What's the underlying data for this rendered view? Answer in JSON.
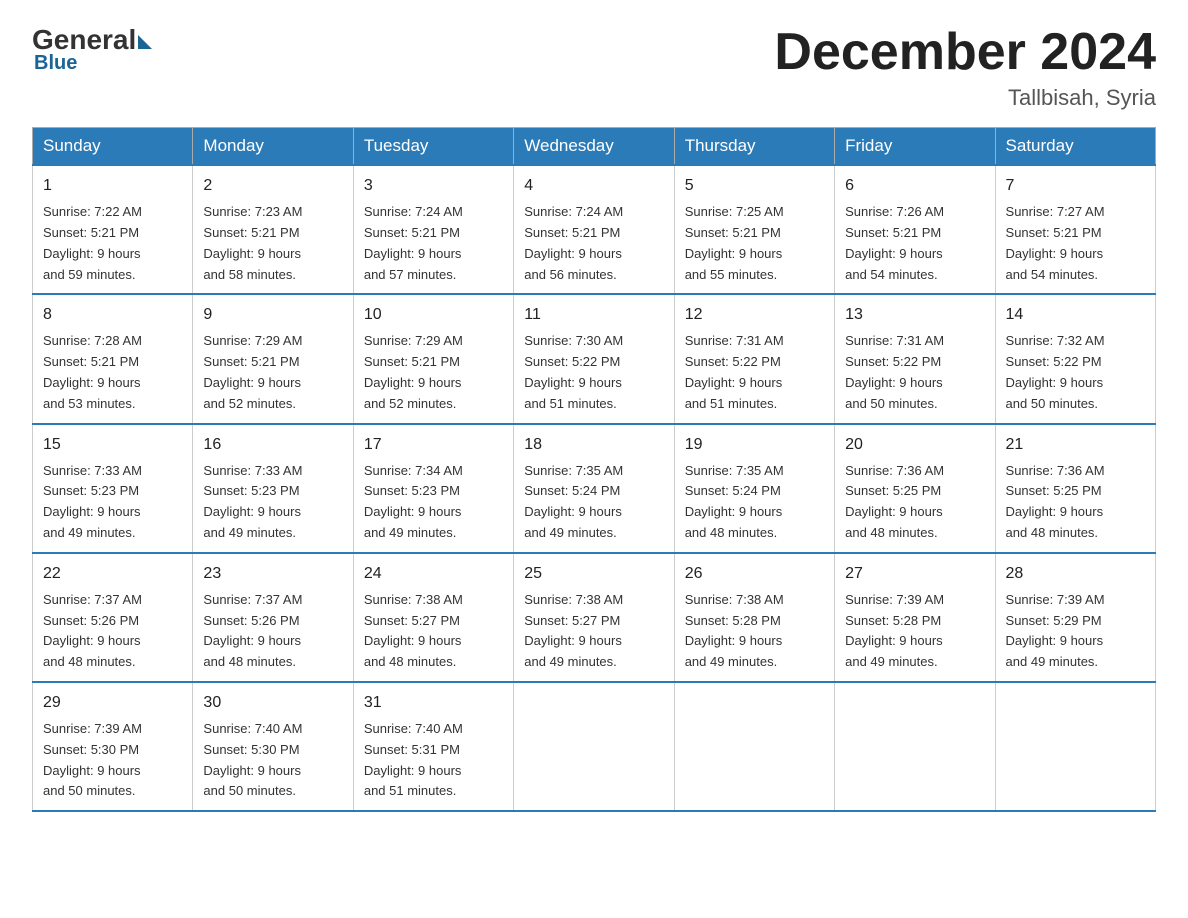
{
  "logo": {
    "general": "General",
    "blue": "Blue"
  },
  "title": "December 2024",
  "location": "Tallbisah, Syria",
  "days_of_week": [
    "Sunday",
    "Monday",
    "Tuesday",
    "Wednesday",
    "Thursday",
    "Friday",
    "Saturday"
  ],
  "weeks": [
    [
      {
        "day": "1",
        "sunrise": "7:22 AM",
        "sunset": "5:21 PM",
        "daylight": "9 hours and 59 minutes."
      },
      {
        "day": "2",
        "sunrise": "7:23 AM",
        "sunset": "5:21 PM",
        "daylight": "9 hours and 58 minutes."
      },
      {
        "day": "3",
        "sunrise": "7:24 AM",
        "sunset": "5:21 PM",
        "daylight": "9 hours and 57 minutes."
      },
      {
        "day": "4",
        "sunrise": "7:24 AM",
        "sunset": "5:21 PM",
        "daylight": "9 hours and 56 minutes."
      },
      {
        "day": "5",
        "sunrise": "7:25 AM",
        "sunset": "5:21 PM",
        "daylight": "9 hours and 55 minutes."
      },
      {
        "day": "6",
        "sunrise": "7:26 AM",
        "sunset": "5:21 PM",
        "daylight": "9 hours and 54 minutes."
      },
      {
        "day": "7",
        "sunrise": "7:27 AM",
        "sunset": "5:21 PM",
        "daylight": "9 hours and 54 minutes."
      }
    ],
    [
      {
        "day": "8",
        "sunrise": "7:28 AM",
        "sunset": "5:21 PM",
        "daylight": "9 hours and 53 minutes."
      },
      {
        "day": "9",
        "sunrise": "7:29 AM",
        "sunset": "5:21 PM",
        "daylight": "9 hours and 52 minutes."
      },
      {
        "day": "10",
        "sunrise": "7:29 AM",
        "sunset": "5:21 PM",
        "daylight": "9 hours and 52 minutes."
      },
      {
        "day": "11",
        "sunrise": "7:30 AM",
        "sunset": "5:22 PM",
        "daylight": "9 hours and 51 minutes."
      },
      {
        "day": "12",
        "sunrise": "7:31 AM",
        "sunset": "5:22 PM",
        "daylight": "9 hours and 51 minutes."
      },
      {
        "day": "13",
        "sunrise": "7:31 AM",
        "sunset": "5:22 PM",
        "daylight": "9 hours and 50 minutes."
      },
      {
        "day": "14",
        "sunrise": "7:32 AM",
        "sunset": "5:22 PM",
        "daylight": "9 hours and 50 minutes."
      }
    ],
    [
      {
        "day": "15",
        "sunrise": "7:33 AM",
        "sunset": "5:23 PM",
        "daylight": "9 hours and 49 minutes."
      },
      {
        "day": "16",
        "sunrise": "7:33 AM",
        "sunset": "5:23 PM",
        "daylight": "9 hours and 49 minutes."
      },
      {
        "day": "17",
        "sunrise": "7:34 AM",
        "sunset": "5:23 PM",
        "daylight": "9 hours and 49 minutes."
      },
      {
        "day": "18",
        "sunrise": "7:35 AM",
        "sunset": "5:24 PM",
        "daylight": "9 hours and 49 minutes."
      },
      {
        "day": "19",
        "sunrise": "7:35 AM",
        "sunset": "5:24 PM",
        "daylight": "9 hours and 48 minutes."
      },
      {
        "day": "20",
        "sunrise": "7:36 AM",
        "sunset": "5:25 PM",
        "daylight": "9 hours and 48 minutes."
      },
      {
        "day": "21",
        "sunrise": "7:36 AM",
        "sunset": "5:25 PM",
        "daylight": "9 hours and 48 minutes."
      }
    ],
    [
      {
        "day": "22",
        "sunrise": "7:37 AM",
        "sunset": "5:26 PM",
        "daylight": "9 hours and 48 minutes."
      },
      {
        "day": "23",
        "sunrise": "7:37 AM",
        "sunset": "5:26 PM",
        "daylight": "9 hours and 48 minutes."
      },
      {
        "day": "24",
        "sunrise": "7:38 AM",
        "sunset": "5:27 PM",
        "daylight": "9 hours and 48 minutes."
      },
      {
        "day": "25",
        "sunrise": "7:38 AM",
        "sunset": "5:27 PM",
        "daylight": "9 hours and 49 minutes."
      },
      {
        "day": "26",
        "sunrise": "7:38 AM",
        "sunset": "5:28 PM",
        "daylight": "9 hours and 49 minutes."
      },
      {
        "day": "27",
        "sunrise": "7:39 AM",
        "sunset": "5:28 PM",
        "daylight": "9 hours and 49 minutes."
      },
      {
        "day": "28",
        "sunrise": "7:39 AM",
        "sunset": "5:29 PM",
        "daylight": "9 hours and 49 minutes."
      }
    ],
    [
      {
        "day": "29",
        "sunrise": "7:39 AM",
        "sunset": "5:30 PM",
        "daylight": "9 hours and 50 minutes."
      },
      {
        "day": "30",
        "sunrise": "7:40 AM",
        "sunset": "5:30 PM",
        "daylight": "9 hours and 50 minutes."
      },
      {
        "day": "31",
        "sunrise": "7:40 AM",
        "sunset": "5:31 PM",
        "daylight": "9 hours and 51 minutes."
      },
      null,
      null,
      null,
      null
    ]
  ],
  "labels": {
    "sunrise": "Sunrise:",
    "sunset": "Sunset:",
    "daylight": "Daylight:"
  }
}
